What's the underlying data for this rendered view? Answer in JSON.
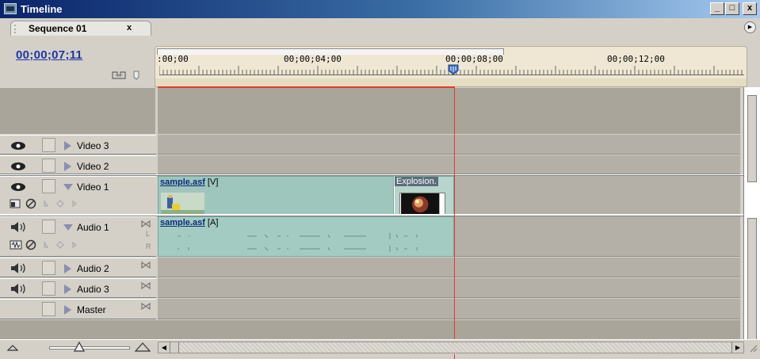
{
  "window": {
    "title": "Timeline",
    "min": "_",
    "max": "□",
    "close": "x"
  },
  "tab": {
    "label": "Sequence 01",
    "close": "x"
  },
  "timecode": "00;00;07;11",
  "ruler": {
    "labels": [
      ":00;00",
      "00;00;04;00",
      "00;00;08;00",
      "00;00;12;00"
    ]
  },
  "tracks": {
    "video3": "Video 3",
    "video2": "Video 2",
    "video1": "Video 1",
    "audio1": "Audio 1",
    "audio2": "Audio 2",
    "audio3": "Audio 3",
    "master": "Master"
  },
  "channels": {
    "left": "L",
    "right": "R"
  },
  "clips": {
    "video_name": "sample.asf",
    "video_suffix": " [V]",
    "explosion": "Explosion.",
    "audio_name": "sample.asf",
    "audio_suffix": " [A]"
  },
  "colors": {
    "playhead": "#e13c27",
    "clip": "#9fc6bd",
    "timecode": "#1f35a6"
  }
}
